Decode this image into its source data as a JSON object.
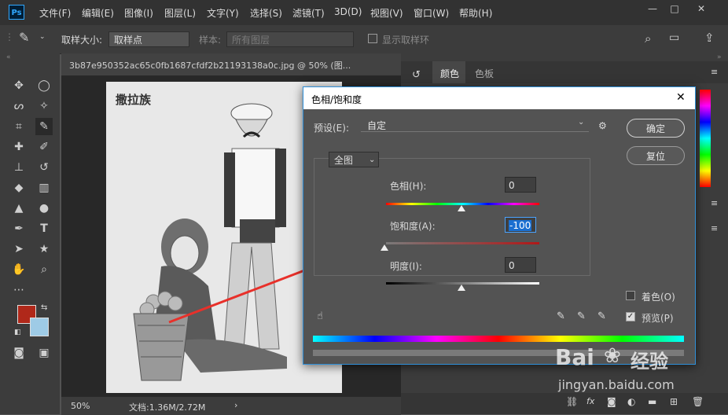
{
  "app": {
    "logo": "Ps",
    "menu": [
      "文件(F)",
      "编辑(E)",
      "图像(I)",
      "图层(L)",
      "文字(Y)",
      "选择(S)",
      "滤镜(T)",
      "3D(D)",
      "视图(V)",
      "窗口(W)",
      "帮助(H)"
    ],
    "window_buttons": [
      "—",
      "□",
      "✕"
    ]
  },
  "options_bar": {
    "sample_size_label": "取样大小:",
    "sample_size_value": "取样点",
    "sample_label": "样本:",
    "sample_value": "所有图层",
    "show_ring_label": "显示取样环"
  },
  "document": {
    "tab_title": "3b87e950352ac65c0fb1687cfdf2b21193138a0c.jpg @ 50% (图...",
    "zoom": "50%",
    "doc_size": "文档:1.36M/2.72M",
    "canvas_caption": "撒拉族"
  },
  "panels": {
    "tabs": [
      "颜色",
      "色板"
    ]
  },
  "colors": {
    "foreground": "#b0281a",
    "background": "#9ecbe6",
    "dialog_border": "#2f8fd8",
    "arrow": "#e8302a"
  },
  "dialog": {
    "title": "色相/饱和度",
    "close": "✕",
    "preset_label": "预设(E):",
    "preset_value": "自定",
    "ok": "确定",
    "reset": "复位",
    "channel": "全图",
    "hue_label": "色相(H):",
    "hue_value": "0",
    "saturation_label": "饱和度(A):",
    "saturation_value": "-100",
    "lightness_label": "明度(I):",
    "lightness_value": "0",
    "colorize_label": "着色(O)",
    "colorize_checked": false,
    "preview_label": "预览(P)",
    "preview_checked": true
  },
  "watermark": {
    "brand": "Bai",
    "brand2": "经验",
    "url": "jingyan.baidu.com"
  }
}
